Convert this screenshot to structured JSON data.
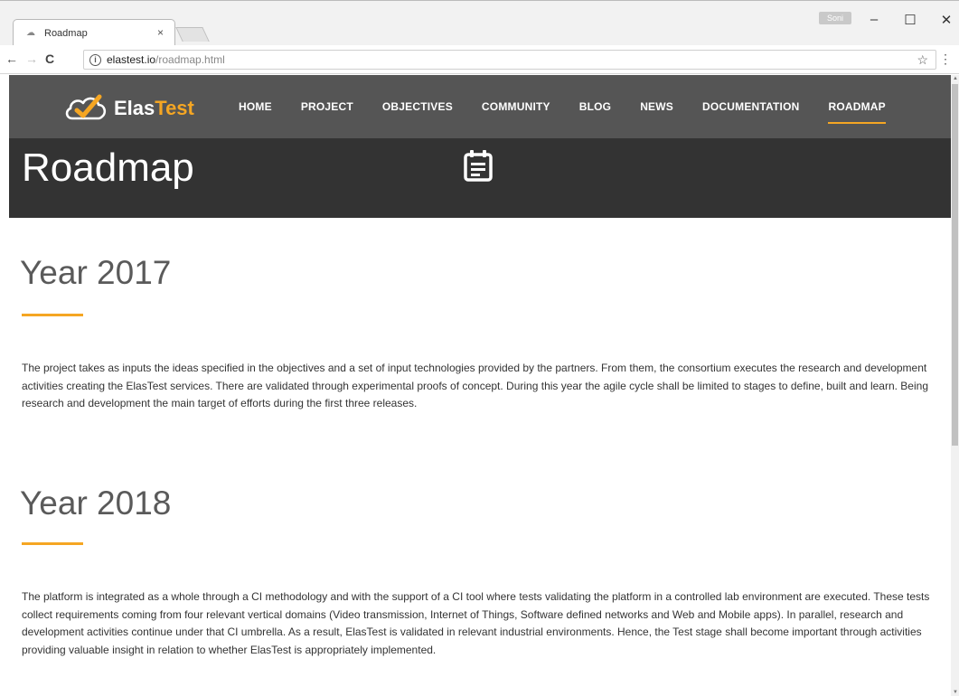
{
  "browser": {
    "tab_title": "Roadmap",
    "tab_close": "×",
    "profile_name": "Soni",
    "url_host": "elastest.io",
    "url_path": "/roadmap.html"
  },
  "site": {
    "logo_text_plain": "Elas",
    "logo_text_accent": "Test",
    "accent_color": "#f5a623",
    "nav": [
      {
        "label": "HOME"
      },
      {
        "label": "PROJECT"
      },
      {
        "label": "OBJECTIVES"
      },
      {
        "label": "COMMUNITY"
      },
      {
        "label": "BLOG"
      },
      {
        "label": "NEWS"
      },
      {
        "label": "DOCUMENTATION"
      },
      {
        "label": "ROADMAP",
        "active": true
      }
    ]
  },
  "hero": {
    "title": "Roadmap",
    "icon": "calendar-icon"
  },
  "sections": [
    {
      "title": "Year 2017",
      "text": "The project takes as inputs the ideas specified in the objectives and a set of input technologies provided by the partners. From them, the consortium executes the research and development activities creating the ElasTest services. There are validated through experimental proofs of concept. During this year the agile cycle shall be limited to stages to define, built and learn. Being research and development the main target of efforts during the first three releases."
    },
    {
      "title": "Year 2018",
      "text": "The platform is integrated as a whole through a CI methodology and with the support of a CI tool where tests validating the platform in a controlled lab environment are executed. These tests collect requirements coming from four relevant vertical domains (Video transmission, Internet of Things, Software defined networks and Web and Mobile apps). In parallel, research and development activities continue under that CI umbrella. As a result, ElasTest is validated in relevant industrial environments. Hence, the Test stage shall become important through activities providing valuable insight in relation to whether ElasTest is appropriately implemented."
    }
  ]
}
